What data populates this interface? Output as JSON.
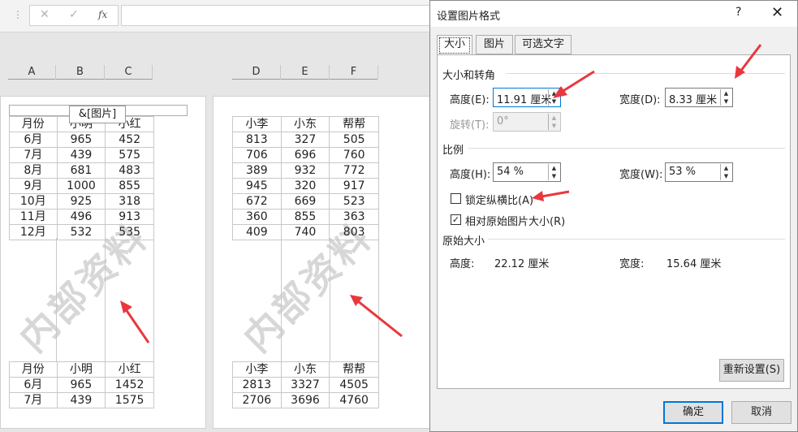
{
  "formula_bar": {
    "cancel_icon": "✕",
    "enter_icon": "✓",
    "fx_label": "fx"
  },
  "columns_left": [
    "A",
    "B",
    "C"
  ],
  "columns_right": [
    "D",
    "E",
    "F"
  ],
  "page_header_code": "&[图片]",
  "watermark": "内部资料",
  "left_table": {
    "header": [
      "月份",
      "小明",
      "小红"
    ],
    "rows": [
      [
        "6月",
        "965",
        "452"
      ],
      [
        "7月",
        "439",
        "575"
      ],
      [
        "8月",
        "681",
        "483"
      ],
      [
        "9月",
        "1000",
        "855"
      ],
      [
        "10月",
        "925",
        "318"
      ],
      [
        "11月",
        "496",
        "913"
      ],
      [
        "12月",
        "532",
        "535"
      ]
    ],
    "repeat_header": [
      "月份",
      "小明",
      "小红"
    ],
    "repeat_rows": [
      [
        "6月",
        "965",
        "1452"
      ],
      [
        "7月",
        "439",
        "1575"
      ]
    ]
  },
  "right_table": {
    "header": [
      "小李",
      "小东",
      "帮帮"
    ],
    "rows": [
      [
        "813",
        "327",
        "505"
      ],
      [
        "706",
        "696",
        "760"
      ],
      [
        "389",
        "932",
        "772"
      ],
      [
        "945",
        "320",
        "917"
      ],
      [
        "672",
        "669",
        "523"
      ],
      [
        "360",
        "855",
        "363"
      ],
      [
        "409",
        "740",
        "803"
      ]
    ],
    "repeat_header": [
      "小李",
      "小东",
      "帮帮"
    ],
    "repeat_rows": [
      [
        "2813",
        "3327",
        "4505"
      ],
      [
        "2706",
        "3696",
        "4760"
      ]
    ]
  },
  "dialog": {
    "title": "设置图片格式",
    "help": "?",
    "close": "✕",
    "tabs": [
      "大小",
      "图片",
      "可选文字"
    ],
    "size_rotate": {
      "section": "大小和转角",
      "height_label": "高度(E):",
      "height_value": "11.91 厘米",
      "width_label": "宽度(D):",
      "width_value": "8.33 厘米",
      "rotate_label": "旋转(T):",
      "rotate_value": "0°"
    },
    "scale": {
      "section": "比例",
      "height_label": "高度(H):",
      "height_value": "54 %",
      "width_label": "宽度(W):",
      "width_value": "53 %",
      "lock_label": "锁定纵横比(A)",
      "lock_checked": false,
      "relative_label": "相对原始图片大小(R)",
      "relative_checked": true
    },
    "original": {
      "section": "原始大小",
      "height_label": "高度:",
      "height_value": "22.12 厘米",
      "width_label": "宽度:",
      "width_value": "15.64 厘米"
    },
    "reset_label": "重新设置(S)",
    "ok_label": "确定",
    "cancel_label": "取消"
  },
  "colors": {
    "arrow": "#e8383d",
    "focus": "#0078d7"
  }
}
